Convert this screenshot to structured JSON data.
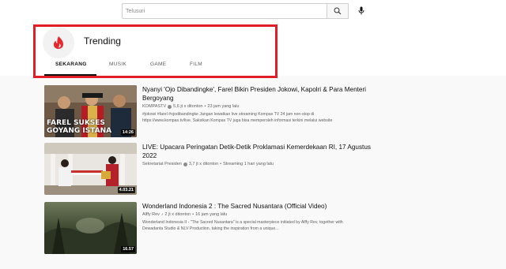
{
  "search": {
    "placeholder": "Telusuri"
  },
  "header": {
    "title": "Trending",
    "tabs": [
      {
        "label": "SEKARANG",
        "active": true
      },
      {
        "label": "MUSIK",
        "active": false
      },
      {
        "label": "GAME",
        "active": false
      },
      {
        "label": "FILM",
        "active": false
      }
    ]
  },
  "videos": [
    {
      "title": "Nyanyi 'Ojo Dibandingke', Farel Bikin Presiden Jokowi, Kapolri & Para Menteri Bergoyang",
      "channel": "KOMPASTV",
      "views": "5,6 jt x ditonton",
      "time": "23 jam yang lalu",
      "description": "#jokowi #farel #ojodibandingke Jangan lewatkan live streaming Kompas TV 24 jam non-stop di https://www.kompas.tv/live. Saksikan Kompas TV juga bisa memperoleh informasi terkini melalui website",
      "duration": "14:26",
      "thumb_text": "FAREL SUKSES GOYANG ISTANA"
    },
    {
      "title": "LIVE: Upacara Peringatan Detik-Detik Proklamasi Kemerdekaan RI, 17 Agustus 2022",
      "channel": "Sekretariat Presiden",
      "views": "3,7 jt x ditonton",
      "time": "Streaming 1 hari yang lalu",
      "description": "",
      "duration": "4.03.21",
      "thumb_text": ""
    },
    {
      "title": "Wonderland Indonesia 2 : The Sacred Nusantara (Official Video)",
      "channel": "Alffy Rev",
      "views": "2 jt x ditonton",
      "time": "16 jam yang lalu",
      "description": "Wonderland Indonesia II - \"The Sacred Nusantara\" is a special masterpiece initiated by Alffy Rev, together with Dewadanta Studio & NLV Production, taking the inspiration from a unique...",
      "duration": "16.57",
      "thumb_text": ""
    }
  ],
  "colors": {
    "highlight": "#e01e25",
    "accent": "#ff0000"
  }
}
